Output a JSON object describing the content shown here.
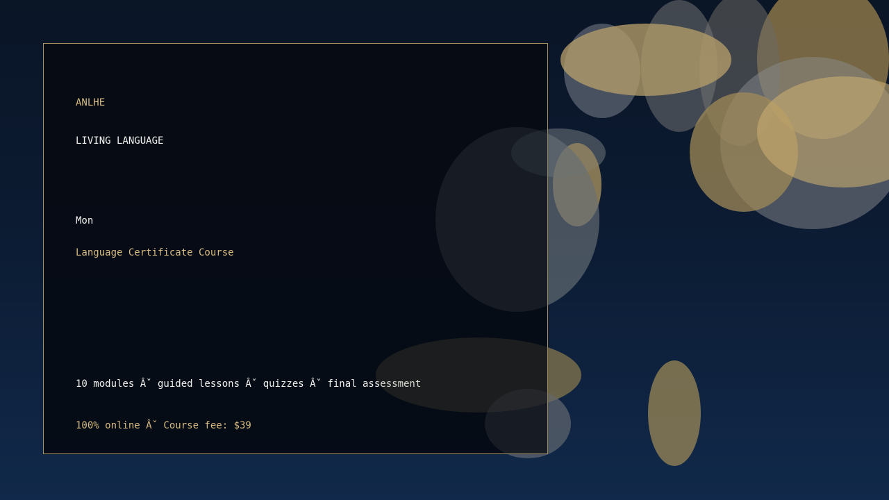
{
  "poster": {
    "brand": "ANLHE",
    "tagline": "LIVING LANGUAGE",
    "day": "Mon",
    "course_title": "Language Certificate Course",
    "details": "10 modules Âˇ guided lessons Âˇ quizzes Âˇ final assessment",
    "fee_line": "100% online Âˇ Course fee: $39"
  },
  "colors": {
    "accent_gold": "#d8bc83",
    "text_white": "#f1f1ee",
    "background_navy": "#0c1c34",
    "card_border": "#a8925f"
  }
}
